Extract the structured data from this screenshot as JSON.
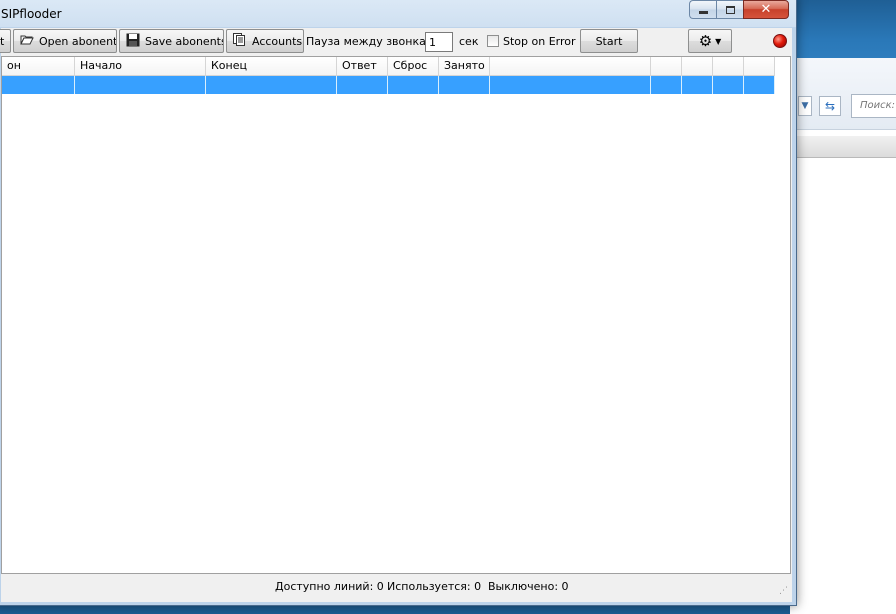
{
  "window": {
    "title": "SIPflooder"
  },
  "toolbar": {
    "edit_label": "t",
    "open_label": "Open abonents",
    "save_label": "Save abonents",
    "accounts_label": "Accounts",
    "pause_label": "Пауза между звонками",
    "pause_value": "1",
    "seconds_label": "сек",
    "stop_on_error_label": "Stop on Error",
    "stop_on_error_checked": false,
    "start_label": "Start",
    "settings_icon": "gear-icon",
    "status_color": "#e21a0a"
  },
  "grid": {
    "columns": [
      "он",
      "Начало",
      "Конец",
      "Ответ",
      "Сброс",
      "Занято",
      "",
      "",
      "",
      "",
      ""
    ],
    "selected_row_color": "#37a0ff"
  },
  "status": {
    "available": "Доступно линий: 0",
    "used": "Используется: 0",
    "disabled": "Выключено: 0"
  },
  "background_window": {
    "search_placeholder": "Поиск:"
  }
}
